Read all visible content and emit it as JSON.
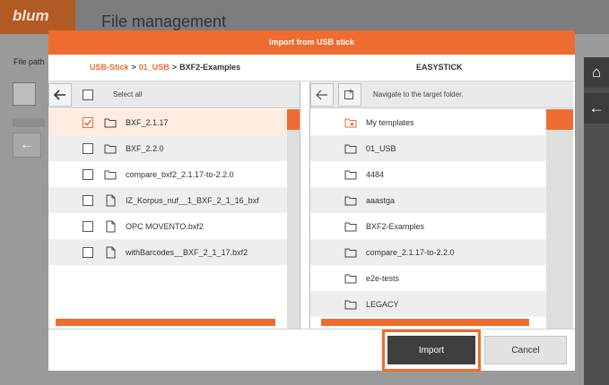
{
  "background": {
    "logo": "blum",
    "title": "File management",
    "file_path_label": "File path"
  },
  "dialog": {
    "title": "Import from USB stick",
    "breadcrumb": {
      "items": [
        "USB-Stick",
        "01_USB"
      ],
      "current": "BXF2-Examples",
      "separator": ">"
    },
    "right_title": "EASYSTICK",
    "left_pane": {
      "select_all_label": "Select all",
      "rows": [
        {
          "type": "folder",
          "label": "BXF_2.1.17",
          "checked": true
        },
        {
          "type": "folder",
          "label": "BXF_2.2.0",
          "checked": false
        },
        {
          "type": "folder",
          "label": "compare_bxf2_2.1.17-to-2.2.0",
          "checked": false
        },
        {
          "type": "file",
          "label": "IZ_Korpus_nuf__1_BXF_2_1_16_bxf",
          "checked": false
        },
        {
          "type": "file",
          "label": "OPC MOVENTO.bxf2",
          "checked": false
        },
        {
          "type": "file",
          "label": "withBarcodes__BXF_2_1_17.bxf2",
          "checked": false
        }
      ]
    },
    "right_pane": {
      "hint": "Navigate to the target folder.",
      "rows": [
        {
          "type": "templates",
          "label": "My templates"
        },
        {
          "type": "folder",
          "label": "01_USB"
        },
        {
          "type": "folder",
          "label": "4484"
        },
        {
          "type": "folder",
          "label": "aaastga"
        },
        {
          "type": "folder",
          "label": "BXF2-Examples"
        },
        {
          "type": "folder",
          "label": "compare_2.1.17-to-2.2.0"
        },
        {
          "type": "folder",
          "label": "e2e-tests"
        },
        {
          "type": "folder",
          "label": "LEGACY"
        }
      ]
    },
    "buttons": {
      "import": "Import",
      "cancel": "Cancel"
    }
  },
  "colors": {
    "accent": "#ee6c2f",
    "button_dark": "#3f3f3f"
  }
}
